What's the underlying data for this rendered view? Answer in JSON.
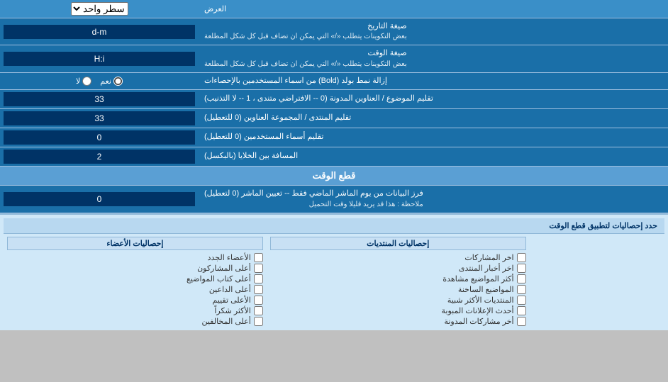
{
  "header": {
    "title": "العرض",
    "dropdown_label": "سطر واحد"
  },
  "rows": [
    {
      "id": "date_format",
      "label": "صيغة التاريخ",
      "sublabel": "بعض التكوينات يتطلب «/» التي يمكن ان تضاف قبل كل شكل المطلعة",
      "input_value": "d-m",
      "type": "text"
    },
    {
      "id": "time_format",
      "label": "صيغة الوقت",
      "sublabel": "بعض التكوينات يتطلب «/» التي يمكن ان تضاف قبل كل شكل المطلعة",
      "input_value": "H:i",
      "type": "text"
    },
    {
      "id": "bold_remove",
      "label": "إزالة نمط بولد (Bold) من اسماء المستخدمين بالإحصاءات",
      "radio_options": [
        {
          "label": "نعم",
          "value": "yes",
          "checked": true
        },
        {
          "label": "لا",
          "value": "no",
          "checked": false
        }
      ],
      "type": "radio"
    },
    {
      "id": "topic_titles",
      "label": "تقليم الموضوع / العناوين المدونة (0 -- الافتراضي متندى ، 1 -- لا التذنيب)",
      "input_value": "33",
      "type": "text"
    },
    {
      "id": "forum_titles",
      "label": "تقليم المنتدى / المجموعة العناوين (0 للتعطيل)",
      "input_value": "33",
      "type": "text"
    },
    {
      "id": "usernames",
      "label": "تقليم أسماء المستخدمين (0 للتعطيل)",
      "input_value": "0",
      "type": "text"
    },
    {
      "id": "cell_spacing",
      "label": "المسافة بين الخلايا (بالبكسل)",
      "input_value": "2",
      "type": "text"
    }
  ],
  "cutoff_section": {
    "title": "قطع الوقت",
    "row": {
      "id": "cutoff_days",
      "label": "فرز البيانات من يوم الماشر الماضي فقط -- تعيين الماشر (0 لتعطيل)",
      "sublabel": "ملاحظة : هذا قد يريد قليلا وقت التحميل",
      "input_value": "0",
      "type": "text"
    },
    "stats_apply_label": "حدد إحصاليات لتطبيق قطع الوقت"
  },
  "stats_columns": [
    {
      "id": "col1",
      "title": "",
      "items": []
    },
    {
      "id": "posts_stats",
      "title": "إحصاليات المنتديات",
      "items": [
        {
          "label": "اخر المشاركات",
          "checked": false
        },
        {
          "label": "اخر أخبار المنتدى",
          "checked": false
        },
        {
          "label": "أكثر المواضيع مشاهدة",
          "checked": false
        },
        {
          "label": "المواضيع الساخنة",
          "checked": false
        },
        {
          "label": "المنتديات الأكثر شبية",
          "checked": false
        },
        {
          "label": "أحدث الإعلانات المبوبة",
          "checked": false
        },
        {
          "label": "أخر مشاركات المدونة",
          "checked": false
        }
      ]
    },
    {
      "id": "members_stats",
      "title": "إحصاليات الأعضاء",
      "items": [
        {
          "label": "الأعضاء الجدد",
          "checked": false
        },
        {
          "label": "أعلى المشاركون",
          "checked": false
        },
        {
          "label": "أعلى كتاب المواضيع",
          "checked": false
        },
        {
          "label": "أعلى الداعين",
          "checked": false
        },
        {
          "label": "الأعلى تقييم",
          "checked": false
        },
        {
          "label": "الأكثر شكراً",
          "checked": false
        },
        {
          "label": "أعلى المخالفين",
          "checked": false
        }
      ]
    }
  ]
}
